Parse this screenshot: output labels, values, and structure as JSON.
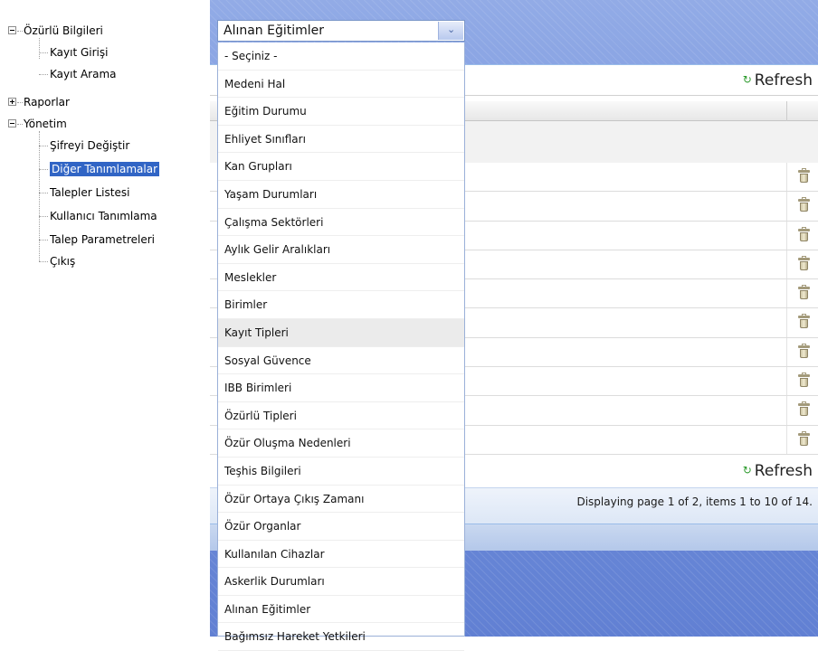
{
  "tree": {
    "nodes": [
      {
        "label": "Özürlü Bilgileri",
        "type": "folder",
        "state": "expanded"
      },
      {
        "label": "Kayıt Girişi",
        "type": "leaf"
      },
      {
        "label": "Kayıt Arama",
        "type": "leaf"
      },
      {
        "label": "Raporlar",
        "type": "folder",
        "state": "collapsed"
      },
      {
        "label": "Yönetim",
        "type": "folder",
        "state": "expanded"
      },
      {
        "label": "Şifreyi Değiştir",
        "type": "leaf"
      },
      {
        "label": "Diğer Tanımlamalar",
        "type": "leaf",
        "selected": true
      },
      {
        "label": "Talepler Listesi",
        "type": "leaf"
      },
      {
        "label": "Kullanıcı Tanımlama",
        "type": "leaf"
      },
      {
        "label": "Talep Parametreleri",
        "type": "leaf"
      },
      {
        "label": "Çıkış",
        "type": "leaf"
      }
    ]
  },
  "combo": {
    "selected": "Alınan Eğitimler",
    "arrow_icon": "chevron-down-icon"
  },
  "dropdown": {
    "options": [
      "- Seçiniz -",
      "Medeni Hal",
      "Eğitim Durumu",
      "Ehliyet Sınıfları",
      "Kan Grupları",
      "Yaşam Durumları",
      "Çalışma Sektörleri",
      "Aylık Gelir Aralıkları",
      "Meslekler",
      "Birimler",
      "Kayıt Tipleri",
      "Sosyal Güvence",
      "IBB Birimleri",
      "Özürlü Tipleri",
      "Özür Oluşma Nedenleri",
      "Teşhis Bilgileri",
      "Özür Ortaya Çıkış Zamanı",
      "Özür Organlar",
      "Kullanılan Cihazlar",
      "Askerlik Durumları",
      "Alınan Eğitimler",
      "Bağımsız Hareket Yetkileri"
    ],
    "highlighted": "Kayıt Tipleri"
  },
  "grid": {
    "refresh_label": "Refresh",
    "refresh_icon": "refresh-icon",
    "row_count": 10,
    "row_action_icon": "trash-icon",
    "paging_text": "Displaying page 1 of 2, items 1 to 10 of 14."
  },
  "colors": {
    "selection": "#3165c5",
    "panel_background": "#6e8ed8",
    "refresh_icon": "#2e9b2e"
  }
}
